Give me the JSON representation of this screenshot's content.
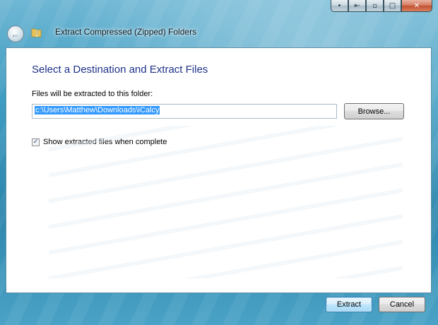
{
  "window": {
    "title": "Extract Compressed (Zipped) Folders",
    "caption_buttons": [
      "help",
      "pin",
      "restore-down",
      "maximize",
      "close"
    ]
  },
  "content": {
    "heading": "Select a Destination and Extract Files",
    "destination_label": "Files will be extracted to this folder:",
    "destination_value": "c:\\Users\\Matthew\\Downloads\\iCalcy",
    "browse_label": "Browse...",
    "show_files_label": "Show extracted files when complete",
    "show_files_checked": true
  },
  "footer": {
    "extract_label": "Extract",
    "cancel_label": "Cancel"
  },
  "colors": {
    "heading": "#1e3287",
    "selection": "#3399ff",
    "frame": "#3f9cc2"
  }
}
